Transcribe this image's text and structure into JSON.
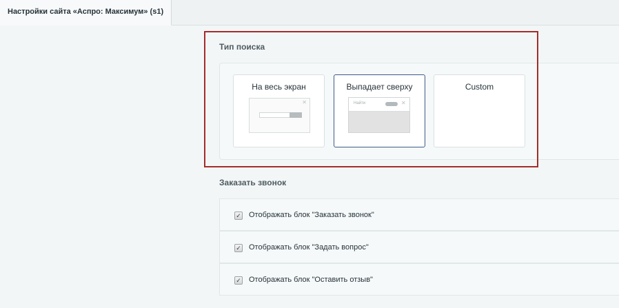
{
  "tab": {
    "title": "Настройки сайта «Аспро: Максимум» (s1)"
  },
  "search_type": {
    "title": "Тип поиска",
    "options": [
      {
        "label": "На весь экран",
        "selected": false
      },
      {
        "label": "Выпадает сверху",
        "selected": true,
        "thumb_placeholder": "Найти"
      },
      {
        "label": "Custom",
        "selected": false
      }
    ]
  },
  "callback": {
    "title": "Заказать звонок",
    "items": [
      {
        "label": "Отображать блок \"Заказать звонок\"",
        "checked": true
      },
      {
        "label": "Отображать блок \"Задать вопрос\"",
        "checked": true
      },
      {
        "label": "Отображать блок \"Оставить отзыв\"",
        "checked": true
      }
    ]
  },
  "colors": {
    "highlight": "#a52a2a",
    "selected_border": "#3b5a8a"
  }
}
